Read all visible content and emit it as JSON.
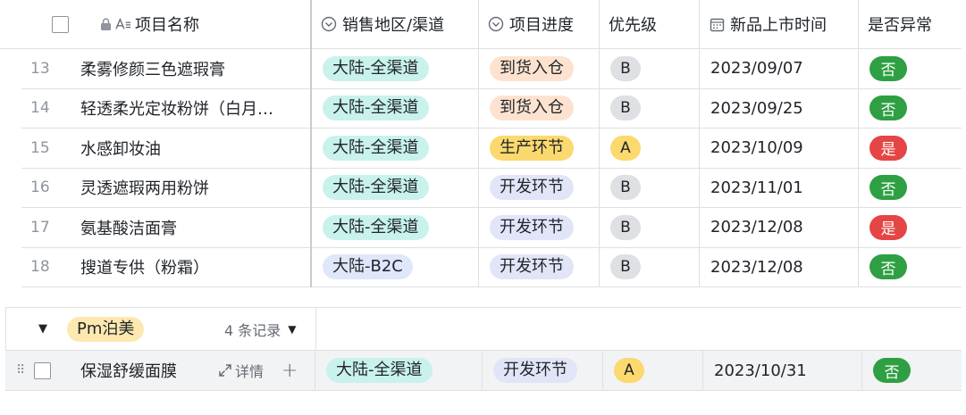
{
  "header": {
    "name_col": "项目名称",
    "region_col": "销售地区/渠道",
    "progress_col": "项目进度",
    "priority_col": "优先级",
    "launch_col": "新品上市时间",
    "abnormal_col": "是否异常"
  },
  "rows": [
    {
      "idx": "13",
      "name": "柔雾修颜三色遮瑕膏",
      "region": "大陆-全渠道",
      "progress": "到货入仓",
      "priority": "B",
      "date": "2023/09/07",
      "abnormal": "否"
    },
    {
      "idx": "14",
      "name": "轻透柔光定妆粉饼（白月…",
      "region": "大陆-全渠道",
      "progress": "到货入仓",
      "priority": "B",
      "date": "2023/09/25",
      "abnormal": "否"
    },
    {
      "idx": "15",
      "name": "水感卸妆油",
      "region": "大陆-全渠道",
      "progress": "生产环节",
      "priority": "A",
      "date": "2023/10/09",
      "abnormal": "是"
    },
    {
      "idx": "16",
      "name": "灵透遮瑕两用粉饼",
      "region": "大陆-全渠道",
      "progress": "开发环节",
      "priority": "B",
      "date": "2023/11/01",
      "abnormal": "否"
    },
    {
      "idx": "17",
      "name": "氨基酸洁面膏",
      "region": "大陆-全渠道",
      "progress": "开发环节",
      "priority": "B",
      "date": "2023/12/08",
      "abnormal": "是"
    },
    {
      "idx": "18",
      "name": "搜道专供（粉霜）",
      "region": "大陆-B2C",
      "progress": "开发环节",
      "priority": "B",
      "date": "2023/12/08",
      "abnormal": "否"
    }
  ],
  "group": {
    "label": "Pm泊美",
    "count": "4 条记录",
    "row": {
      "name": "保湿舒缓面膜",
      "detail": "详情",
      "region": "大陆-全渠道",
      "progress": "开发环节",
      "priority": "A",
      "date": "2023/10/31",
      "abnormal": "否"
    }
  },
  "colors": {
    "tag_green": "#c9f2ec",
    "tag_blue": "#e1e7fb",
    "tag_orange": "#fde3cf",
    "tag_yellow": "#fbd96e",
    "yes": "#e54545",
    "no": "#2ea043"
  }
}
